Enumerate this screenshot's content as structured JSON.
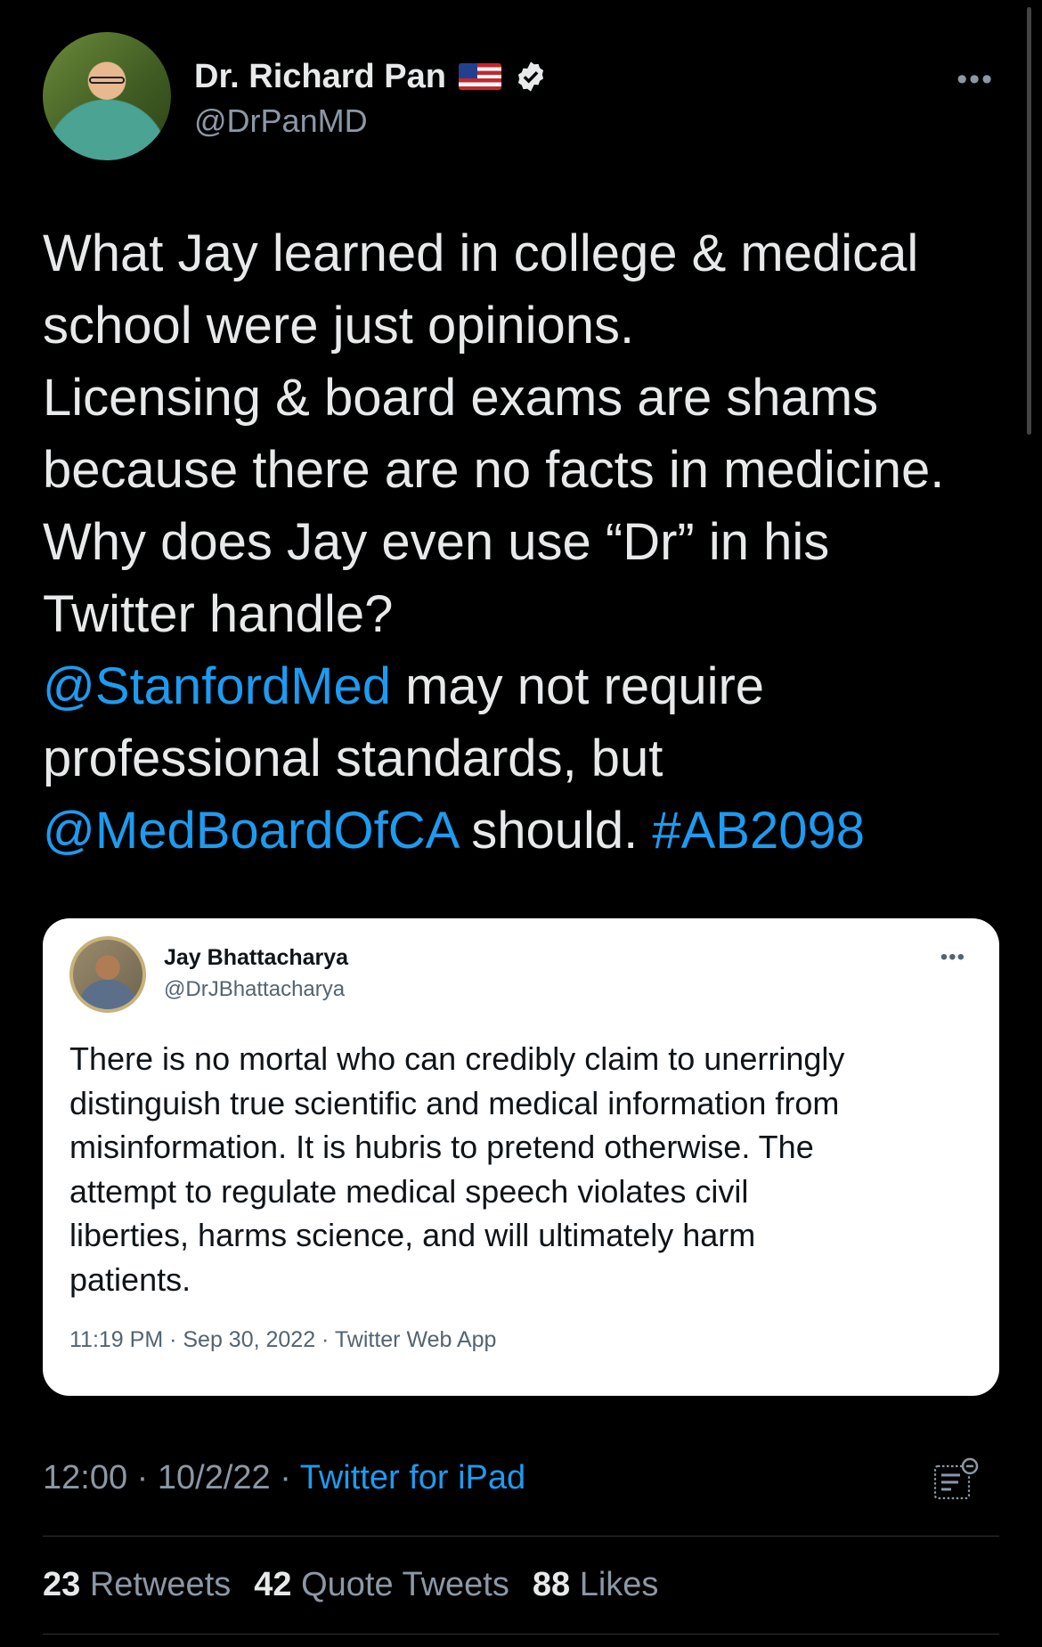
{
  "author": {
    "display_name": "Dr. Richard Pan",
    "handle": "@DrPanMD",
    "flag_icon": "us-flag-icon",
    "verified_icon": "verified-badge-icon"
  },
  "tweet": {
    "lines": [
      [
        {
          "t": "What Jay learned in college & medical",
          "link": false
        }
      ],
      [
        {
          "t": "school were just opinions.",
          "link": false
        }
      ],
      [
        {
          "t": "Licensing & board exams are shams",
          "link": false
        }
      ],
      [
        {
          "t": "because there are no facts in medicine.",
          "link": false
        }
      ],
      [
        {
          "t": "Why does Jay even use “Dr” in his",
          "link": false
        }
      ],
      [
        {
          "t": "Twitter handle?",
          "link": false
        }
      ],
      [
        {
          "t": "@StanfordMed",
          "link": true
        },
        {
          "t": " may not require",
          "link": false
        }
      ],
      [
        {
          "t": "professional standards, but",
          "link": false
        }
      ],
      [
        {
          "t": "@MedBoardOfCA",
          "link": true
        },
        {
          "t": " should. ",
          "link": false
        },
        {
          "t": "#AB2098",
          "link": true
        }
      ]
    ]
  },
  "quoted": {
    "display_name": "Jay Bhattacharya",
    "handle": "@DrJBhattacharya",
    "lines": [
      "There is no mortal who can credibly claim to unerringly",
      "distinguish true scientific and medical information from",
      "misinformation. It is hubris to pretend otherwise. The",
      "attempt to regulate medical speech violates civil",
      "liberties, harms science, and will ultimately harm",
      "patients."
    ],
    "meta": "11:19 PM · Sep 30, 2022 · Twitter Web App"
  },
  "meta": {
    "time_date": "12:00 · 10/2/22 · ",
    "source": "Twitter for iPad"
  },
  "stats": {
    "retweets_count": "23",
    "retweets_label": "Retweets",
    "quotes_count": "42",
    "quotes_label": "Quote Tweets",
    "likes_count": "88",
    "likes_label": "Likes"
  },
  "colors": {
    "link": "#1d9bf0",
    "background": "#000000",
    "muted": "#8b98a5"
  }
}
